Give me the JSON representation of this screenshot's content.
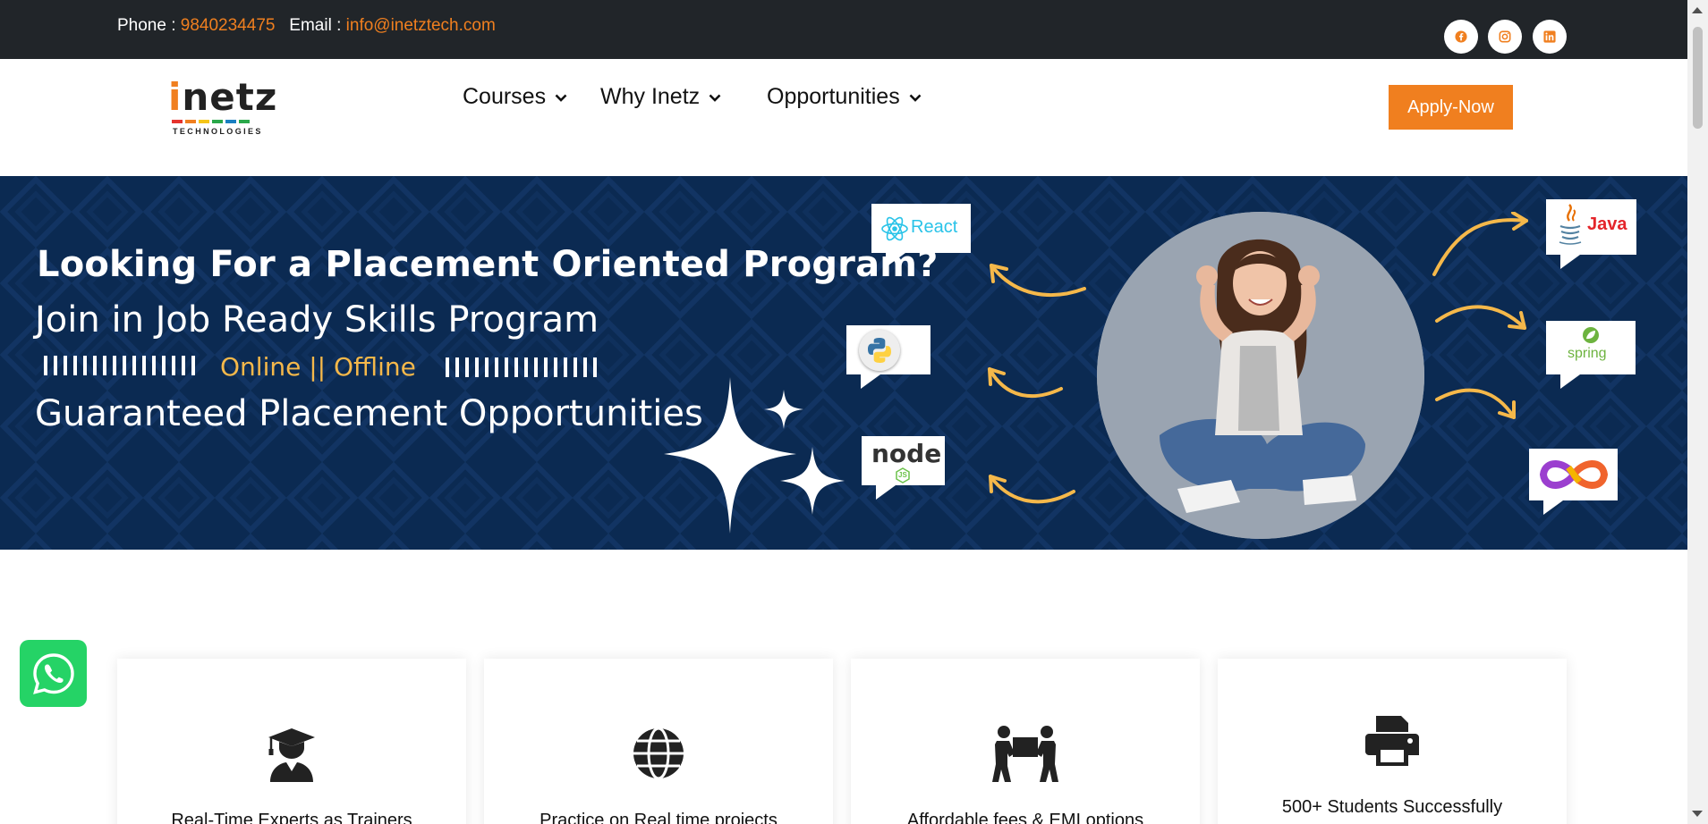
{
  "topbar": {
    "phone_label": "Phone : ",
    "phone_value": "9840234475",
    "email_label": "Email : ",
    "email_value": "info@inetztech.com",
    "social_icons": [
      "facebook-icon",
      "instagram-icon",
      "linkedin-icon"
    ],
    "accent_color": "#f07f1f"
  },
  "logo": {
    "word_i": "i",
    "word_rest": "netz",
    "subtitle": "TECHNOLOGIES",
    "bar_colors": [
      "#e5322d",
      "#f07f1f",
      "#f5c518",
      "#2aa84a",
      "#1a7fc1",
      "#2aa84a"
    ]
  },
  "nav": {
    "items": [
      {
        "label": "Courses"
      },
      {
        "label": "Why Inetz"
      },
      {
        "label": "Opportunities"
      }
    ],
    "apply_label": "Apply-Now"
  },
  "hero": {
    "title": "Looking For a Placement Oriented Program?",
    "subtitle": "Join in Job Ready Skills Program",
    "mode": "Online || Offline",
    "line": "Guaranteed Placement Opportunities",
    "badges": {
      "react": "React",
      "node": "node",
      "node_sub": "JS",
      "java": "Java",
      "spring": "spring"
    }
  },
  "features": [
    {
      "text": "Real-Time Experts as Trainers",
      "icon": "graduate-icon"
    },
    {
      "text": "Practice on Real time projects",
      "icon": "globe-icon"
    },
    {
      "text": "Affordable fees & EMI options",
      "icon": "people-carry-icon"
    },
    {
      "text": "500+ Students Successfully",
      "icon": "printer-icon"
    }
  ],
  "colors": {
    "brand_orange": "#f07f1f",
    "hero_navy": "#0b2a52",
    "topbar_dark": "#212529",
    "whatsapp_green": "#25d366"
  }
}
